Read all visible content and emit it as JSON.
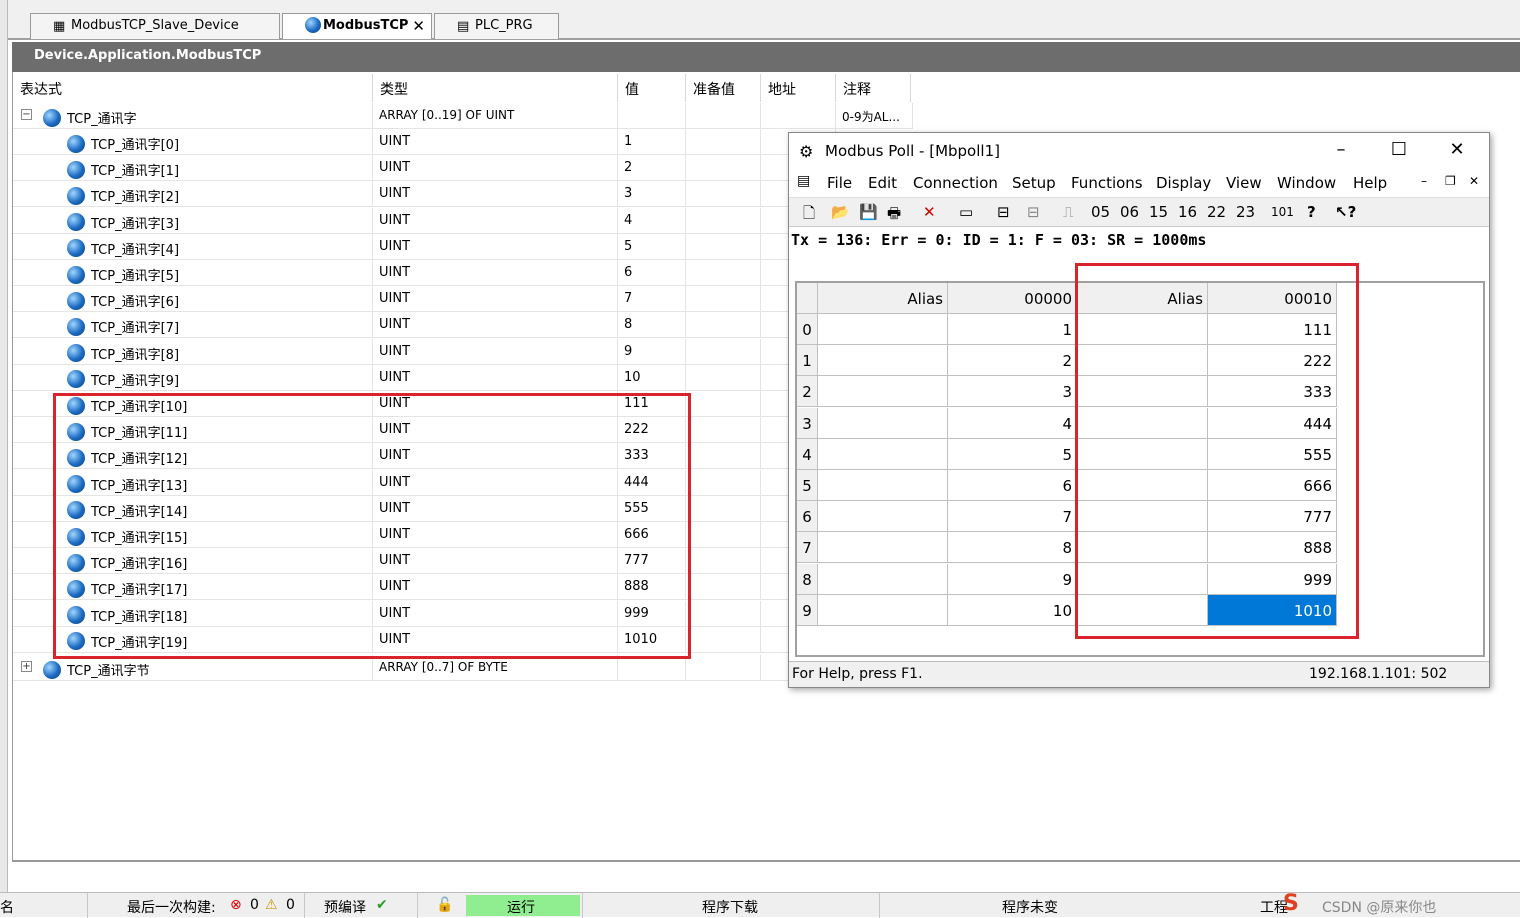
{
  "ide": {
    "tabs": [
      {
        "label": "ModbusTCP_Slave_Device"
      },
      {
        "label": "ModbusTCP",
        "close": "✕"
      },
      {
        "label": "PLC_PRG"
      }
    ],
    "path": "Device.Application.ModbusTCP",
    "columns": [
      "表达式",
      "类型",
      "值",
      "准备值",
      "地址",
      "注释"
    ],
    "root": {
      "expander": "−",
      "name": "TCP_通讯字",
      "type": "ARRAY [0..19] OF UINT",
      "comment": "0-9为AL..."
    },
    "rows": [
      {
        "name": "TCP_通讯字[0]",
        "type": "UINT",
        "value": "1"
      },
      {
        "name": "TCP_通讯字[1]",
        "type": "UINT",
        "value": "2"
      },
      {
        "name": "TCP_通讯字[2]",
        "type": "UINT",
        "value": "3"
      },
      {
        "name": "TCP_通讯字[3]",
        "type": "UINT",
        "value": "4"
      },
      {
        "name": "TCP_通讯字[4]",
        "type": "UINT",
        "value": "5"
      },
      {
        "name": "TCP_通讯字[5]",
        "type": "UINT",
        "value": "6"
      },
      {
        "name": "TCP_通讯字[6]",
        "type": "UINT",
        "value": "7"
      },
      {
        "name": "TCP_通讯字[7]",
        "type": "UINT",
        "value": "8"
      },
      {
        "name": "TCP_通讯字[8]",
        "type": "UINT",
        "value": "9"
      },
      {
        "name": "TCP_通讯字[9]",
        "type": "UINT",
        "value": "10"
      },
      {
        "name": "TCP_通讯字[10]",
        "type": "UINT",
        "value": "111"
      },
      {
        "name": "TCP_通讯字[11]",
        "type": "UINT",
        "value": "222"
      },
      {
        "name": "TCP_通讯字[12]",
        "type": "UINT",
        "value": "333"
      },
      {
        "name": "TCP_通讯字[13]",
        "type": "UINT",
        "value": "444"
      },
      {
        "name": "TCP_通讯字[14]",
        "type": "UINT",
        "value": "555"
      },
      {
        "name": "TCP_通讯字[15]",
        "type": "UINT",
        "value": "666"
      },
      {
        "name": "TCP_通讯字[16]",
        "type": "UINT",
        "value": "777"
      },
      {
        "name": "TCP_通讯字[17]",
        "type": "UINT",
        "value": "888"
      },
      {
        "name": "TCP_通讯字[18]",
        "type": "UINT",
        "value": "999"
      },
      {
        "name": "TCP_通讯字[19]",
        "type": "UINT",
        "value": "1010"
      }
    ],
    "root2": {
      "expander": "+",
      "name": "TCP_通讯字节",
      "type": "ARRAY [0..7] OF BYTE"
    }
  },
  "mbpoll": {
    "title": "Modbus Poll - [Mbpoll1]",
    "menu": [
      "File",
      "Edit",
      "Connection",
      "Setup",
      "Functions",
      "Display",
      "View",
      "Window",
      "Help"
    ],
    "toolbar_codes": [
      "05",
      "06",
      "15",
      "16",
      "22",
      "23"
    ],
    "toolbar_101": "101",
    "status": "Tx = 136: Err = 0: ID = 1: F = 03: SR = 1000ms",
    "grid_headers": [
      "Alias",
      "00000",
      "Alias",
      "00010"
    ],
    "rows": [
      {
        "n": "0",
        "a": "1",
        "b": "111"
      },
      {
        "n": "1",
        "a": "2",
        "b": "222"
      },
      {
        "n": "2",
        "a": "3",
        "b": "333"
      },
      {
        "n": "3",
        "a": "4",
        "b": "444"
      },
      {
        "n": "4",
        "a": "5",
        "b": "555"
      },
      {
        "n": "5",
        "a": "6",
        "b": "666"
      },
      {
        "n": "6",
        "a": "7",
        "b": "777"
      },
      {
        "n": "7",
        "a": "8",
        "b": "888"
      },
      {
        "n": "8",
        "a": "9",
        "b": "999"
      },
      {
        "n": "9",
        "a": "10",
        "b": "1010"
      }
    ],
    "help": "For Help, press F1.",
    "address": "192.168.1.101: 502"
  },
  "bottom": {
    "left_char": "名",
    "build_label": "最后一次构建:",
    "err_count": "0",
    "warn_count": "0",
    "precompile": "预编译",
    "run": "运行",
    "download": "程序下载",
    "unchanged": "程序未变",
    "project": "工程",
    "watermark": "CSDN @原来你也"
  },
  "colors": {
    "highlight": "#d9232d",
    "selection": "#0078d7",
    "run_bg": "#90ee90"
  }
}
